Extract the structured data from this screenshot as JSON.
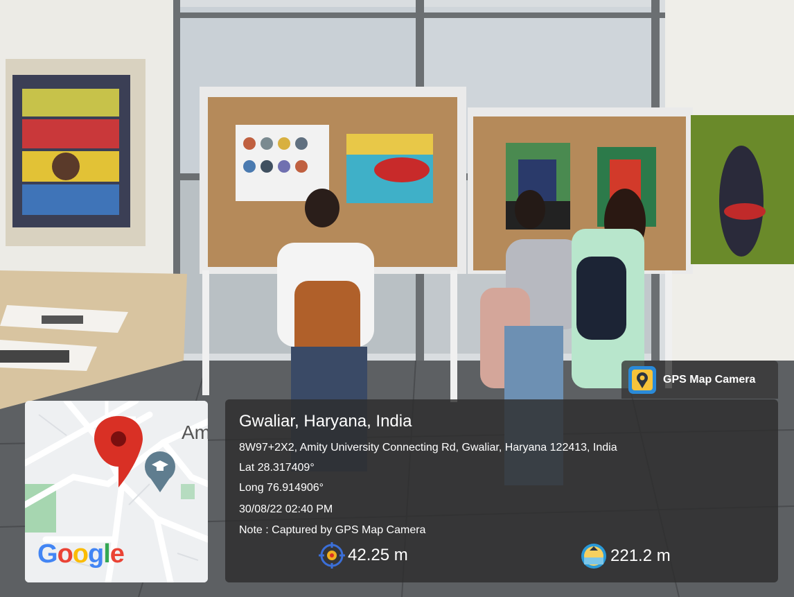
{
  "badge": {
    "app_name": "GPS Map Camera",
    "icon": "gps-camera-app-icon"
  },
  "location": {
    "place": "Gwaliar, Haryana, India",
    "address": "8W97+2X2, Amity University Connecting Rd, Gwaliar, Haryana 122413, India",
    "latitude": "Lat 28.317409°",
    "longitude": "Long 76.914906°",
    "datetime": "30/08/22 02:40 PM",
    "note": "Note : Captured by GPS Map Camera",
    "accuracy": "42.25 m",
    "altitude": "221.2 m"
  },
  "map": {
    "place_label_partial": "Am",
    "logo_letters": [
      "G",
      "o",
      "o",
      "g",
      "l",
      "e"
    ],
    "logo_colors": [
      "#4285F4",
      "#EA4335",
      "#FBBC05",
      "#4285F4",
      "#34A853",
      "#EA4335"
    ],
    "pin_color": "#d93025"
  },
  "colors": {
    "panel_bg": "#2d2d2d",
    "panel_text": "#ffffff",
    "corkboard": "#b58a5a"
  }
}
